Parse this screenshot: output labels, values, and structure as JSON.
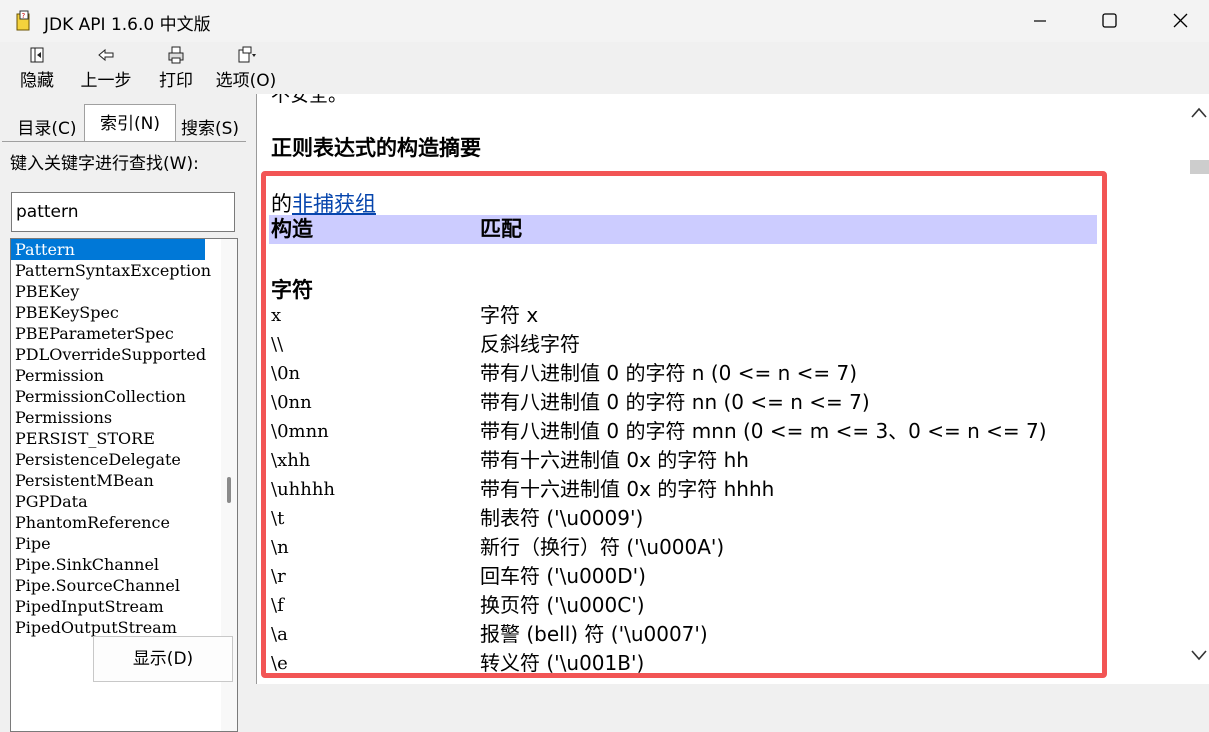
{
  "window": {
    "title": "JDK API 1.6.0 中文版"
  },
  "toolbar": {
    "hide": "隐藏",
    "back": "上一步",
    "print": "打印",
    "options": "选项(O)"
  },
  "tabs": {
    "contents": "目录(C)",
    "index": "索引(N)",
    "search": "搜索(S)"
  },
  "keyword": {
    "label": "键入关键字进行查找(W):",
    "value": "pattern"
  },
  "index_list": [
    "Pattern",
    "PatternSyntaxException",
    "PBEKey",
    "PBEKeySpec",
    "PBEParameterSpec",
    "PDLOverrideSupported",
    "Permission",
    "PermissionCollection",
    "Permissions",
    "PERSIST_STORE",
    "PersistenceDelegate",
    "PersistentMBean",
    "PGPData",
    "PhantomReference",
    "Pipe",
    "Pipe.SinkChannel",
    "Pipe.SourceChannel",
    "PipedInputStream",
    "PipedOutputStream"
  ],
  "display_button": "显示(D)",
  "content": {
    "partial_text": "不安全。",
    "heading": "正则表达式的构造摘要",
    "noncapture_prefix": "的",
    "noncapture_link": "非捕获组",
    "col_construct": "构造",
    "col_match": "匹配",
    "section": "字符",
    "rows": [
      {
        "c": "x",
        "m": "字符 x"
      },
      {
        "c": "\\\\",
        "m": "反斜线字符"
      },
      {
        "c": "\\0n",
        "m": "带有八进制值 0 的字符 n (0 <= n <= 7)"
      },
      {
        "c": "\\0nn",
        "m": "带有八进制值 0 的字符 nn (0 <= n <= 7)"
      },
      {
        "c": "\\0mnn",
        "m": "带有八进制值 0 的字符 mnn (0 <= m <= 3、0 <= n <= 7)"
      },
      {
        "c": "\\xhh",
        "m": "带有十六进制值 0x 的字符 hh"
      },
      {
        "c": "\\uhhhh",
        "m": "带有十六进制值 0x 的字符 hhhh"
      },
      {
        "c": "\\t",
        "m": "制表符 ('\\u0009')"
      },
      {
        "c": "\\n",
        "m": "新行（换行）符 ('\\u000A')"
      },
      {
        "c": "\\r",
        "m": "回车符 ('\\u000D')"
      },
      {
        "c": "\\f",
        "m": "换页符 ('\\u000C')"
      },
      {
        "c": "\\a",
        "m": "报警 (bell) 符 ('\\u0007')"
      },
      {
        "c": "\\e",
        "m": "转义符 ('\\u001B')"
      }
    ]
  }
}
